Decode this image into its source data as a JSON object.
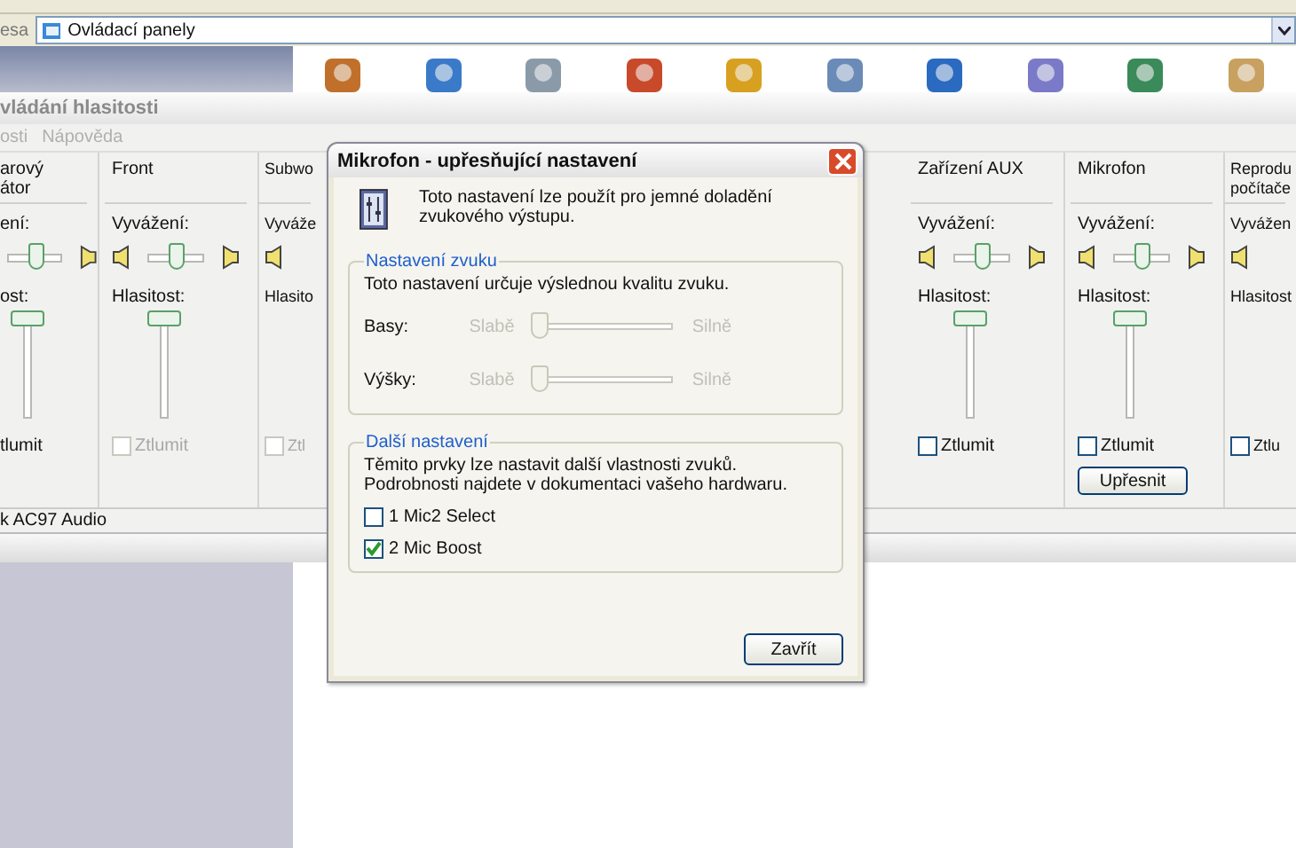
{
  "address_bar": {
    "label": "esa",
    "value": "Ovládací panely"
  },
  "volume_window": {
    "title": "vládání hlasitosti",
    "menu": [
      "osti",
      "Nápověda"
    ],
    "channels": [
      {
        "kind": "cut_left",
        "name": "arový\nátor",
        "balance": {
          "label": "ení:",
          "level": 0.5
        },
        "volume": {
          "label": "ost:",
          "level": 1
        },
        "mute_label": "tlumit"
      },
      {
        "kind": "full",
        "name": "Front",
        "balance": {
          "label": "Vyvážení:",
          "level": 0.5
        },
        "volume": {
          "label": "Hlasitost:",
          "level": 1
        },
        "mute_label": "Ztlumit",
        "mute_checked": false,
        "mute_disabled": true
      },
      {
        "kind": "cut_right",
        "name": "Subwo",
        "balance": {
          "label": "Vyváže"
        },
        "volume": {
          "label": "Hlasito"
        },
        "mute_label": "Ztl",
        "mute_checked": false,
        "mute_disabled": true
      },
      {
        "kind": "gap"
      },
      {
        "kind": "full",
        "name": "Zařízení AUX",
        "balance": {
          "label": "Vyvážení:",
          "level": 0.5
        },
        "volume": {
          "label": "Hlasitost:",
          "level": 1
        },
        "mute_label": "Ztlumit",
        "mute_checked": false,
        "mute_disabled": false
      },
      {
        "kind": "full",
        "name": "Mikrofon",
        "balance": {
          "label": "Vyvážení:",
          "level": 0.5
        },
        "volume": {
          "label": "Hlasitost:",
          "level": 1
        },
        "mute_label": "Ztlumit",
        "mute_checked": false,
        "mute_disabled": false,
        "advanced_button": "Upřesnit"
      },
      {
        "kind": "cut_right",
        "name": "Reprodu\npočítače",
        "balance": {
          "label": "Vyvážen"
        },
        "volume": {
          "label": "Hlasitost"
        },
        "mute_label": "Ztlu",
        "mute_checked": false,
        "mute_disabled": false
      }
    ],
    "status": "k AC97 Audio"
  },
  "dialog": {
    "title": "Mikrofon - upřesňující nastavení",
    "intro": "Toto nastavení lze použít pro jemné doladění zvukového výstupu.",
    "tone_group": {
      "title": "Nastavení zvuku",
      "description": "Toto nastavení určuje výslednou kvalitu zvuku.",
      "disabled": true,
      "sliders": [
        {
          "label": "Basy:",
          "low": "Slabě",
          "high": "Silně",
          "level": 0
        },
        {
          "label": "Výšky:",
          "low": "Slabě",
          "high": "Silně",
          "level": 0
        }
      ]
    },
    "other_group": {
      "title": "Další nastavení",
      "description": "Těmito prvky lze nastavit další vlastnosti zvuků. Podrobnosti najdete v dokumentaci vašeho hardwaru.",
      "options": [
        {
          "label": "1  Mic2 Select",
          "checked": false
        },
        {
          "label": "2  Mic Boost",
          "checked": true
        }
      ]
    },
    "close_button": "Zavřít"
  }
}
